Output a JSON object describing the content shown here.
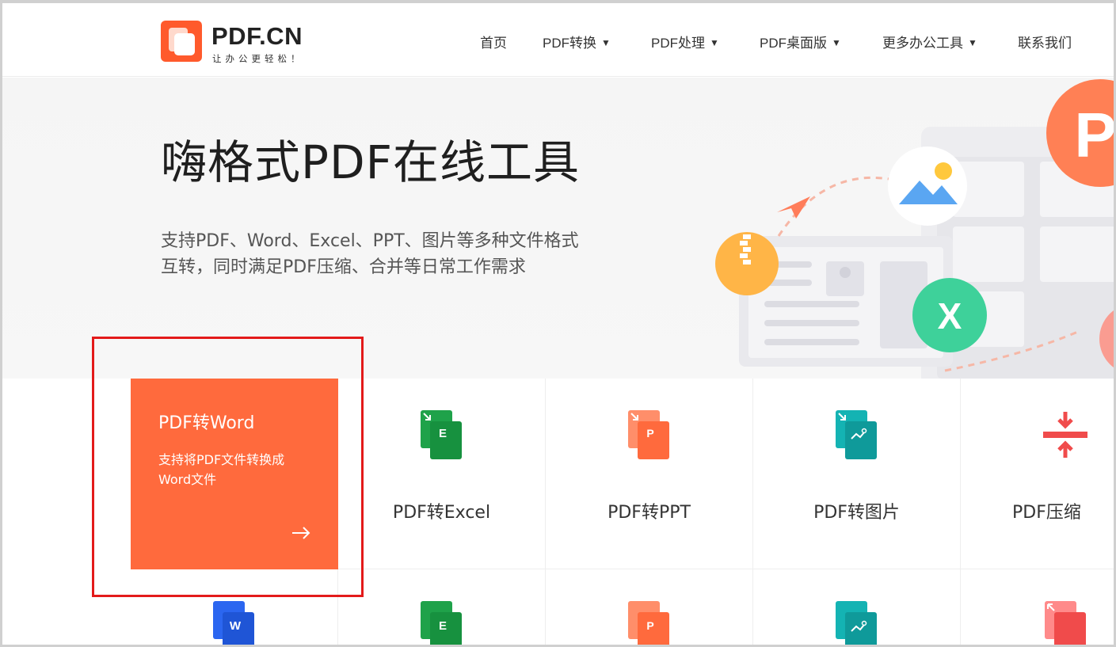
{
  "logo": {
    "title": "PDF.CN",
    "slogan": "让办公更轻松！"
  },
  "nav": {
    "items": [
      {
        "label": "首页",
        "dropdown": false
      },
      {
        "label": "PDF转换",
        "dropdown": true
      },
      {
        "label": "PDF处理",
        "dropdown": true
      },
      {
        "label": "PDF桌面版",
        "dropdown": true
      },
      {
        "label": "更多办公工具",
        "dropdown": true
      },
      {
        "label": "联系我们",
        "dropdown": false
      }
    ],
    "caret": "▼"
  },
  "hero": {
    "title": "嗨格式PDF在线工具",
    "desc_line1": "支持PDF、Word、Excel、PPT、图片等多种文件格式",
    "desc_line2": "互转，同时满足PDF压缩、合并等日常工作需求"
  },
  "illustration": {
    "excel_letter": "X",
    "pdf_letter": "P"
  },
  "tools": {
    "active": {
      "title": "PDF转Word",
      "desc": "支持将PDF文件转换成Word文件",
      "arrow": "→"
    },
    "row1": [
      {
        "label": "PDF转Excel",
        "icon_letter": "E",
        "color": "#1fa24a"
      },
      {
        "label": "PDF转PPT",
        "icon_letter": "P",
        "color": "#ff6a3d"
      },
      {
        "label": "PDF转图片",
        "icon_letter": "",
        "color": "#14b3b3"
      },
      {
        "label": "PDF压缩",
        "icon_letter": "",
        "color": "#f04b4b"
      }
    ],
    "row2": [
      {
        "icon_letter": "W",
        "color": "#2b66f0"
      },
      {
        "icon_letter": "E",
        "color": "#1fa24a"
      },
      {
        "icon_letter": "P",
        "color": "#ff6a3d"
      },
      {
        "icon_letter": "",
        "color": "#14b3b3"
      },
      {
        "icon_letter": "",
        "color": "#f04b4b"
      }
    ]
  },
  "colors": {
    "accent": "#ff6a3d",
    "highlight": "#e31a1a"
  }
}
